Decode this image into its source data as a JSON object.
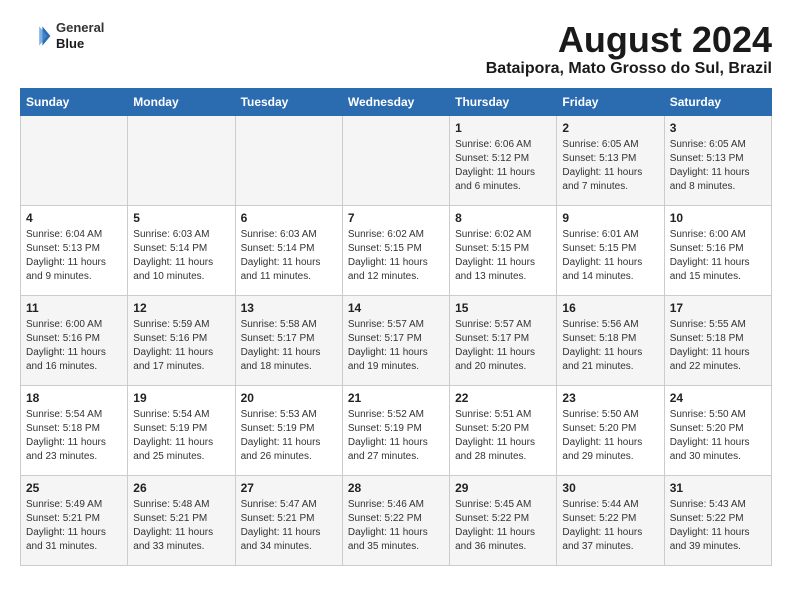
{
  "header": {
    "logo_line1": "General",
    "logo_line2": "Blue",
    "title": "August 2024",
    "subtitle": "Bataipora, Mato Grosso do Sul, Brazil"
  },
  "days_of_week": [
    "Sunday",
    "Monday",
    "Tuesday",
    "Wednesday",
    "Thursday",
    "Friday",
    "Saturday"
  ],
  "weeks": [
    [
      {
        "day": "",
        "info": ""
      },
      {
        "day": "",
        "info": ""
      },
      {
        "day": "",
        "info": ""
      },
      {
        "day": "",
        "info": ""
      },
      {
        "day": "1",
        "info": "Sunrise: 6:06 AM\nSunset: 5:12 PM\nDaylight: 11 hours\nand 6 minutes."
      },
      {
        "day": "2",
        "info": "Sunrise: 6:05 AM\nSunset: 5:13 PM\nDaylight: 11 hours\nand 7 minutes."
      },
      {
        "day": "3",
        "info": "Sunrise: 6:05 AM\nSunset: 5:13 PM\nDaylight: 11 hours\nand 8 minutes."
      }
    ],
    [
      {
        "day": "4",
        "info": "Sunrise: 6:04 AM\nSunset: 5:13 PM\nDaylight: 11 hours\nand 9 minutes."
      },
      {
        "day": "5",
        "info": "Sunrise: 6:03 AM\nSunset: 5:14 PM\nDaylight: 11 hours\nand 10 minutes."
      },
      {
        "day": "6",
        "info": "Sunrise: 6:03 AM\nSunset: 5:14 PM\nDaylight: 11 hours\nand 11 minutes."
      },
      {
        "day": "7",
        "info": "Sunrise: 6:02 AM\nSunset: 5:15 PM\nDaylight: 11 hours\nand 12 minutes."
      },
      {
        "day": "8",
        "info": "Sunrise: 6:02 AM\nSunset: 5:15 PM\nDaylight: 11 hours\nand 13 minutes."
      },
      {
        "day": "9",
        "info": "Sunrise: 6:01 AM\nSunset: 5:15 PM\nDaylight: 11 hours\nand 14 minutes."
      },
      {
        "day": "10",
        "info": "Sunrise: 6:00 AM\nSunset: 5:16 PM\nDaylight: 11 hours\nand 15 minutes."
      }
    ],
    [
      {
        "day": "11",
        "info": "Sunrise: 6:00 AM\nSunset: 5:16 PM\nDaylight: 11 hours\nand 16 minutes."
      },
      {
        "day": "12",
        "info": "Sunrise: 5:59 AM\nSunset: 5:16 PM\nDaylight: 11 hours\nand 17 minutes."
      },
      {
        "day": "13",
        "info": "Sunrise: 5:58 AM\nSunset: 5:17 PM\nDaylight: 11 hours\nand 18 minutes."
      },
      {
        "day": "14",
        "info": "Sunrise: 5:57 AM\nSunset: 5:17 PM\nDaylight: 11 hours\nand 19 minutes."
      },
      {
        "day": "15",
        "info": "Sunrise: 5:57 AM\nSunset: 5:17 PM\nDaylight: 11 hours\nand 20 minutes."
      },
      {
        "day": "16",
        "info": "Sunrise: 5:56 AM\nSunset: 5:18 PM\nDaylight: 11 hours\nand 21 minutes."
      },
      {
        "day": "17",
        "info": "Sunrise: 5:55 AM\nSunset: 5:18 PM\nDaylight: 11 hours\nand 22 minutes."
      }
    ],
    [
      {
        "day": "18",
        "info": "Sunrise: 5:54 AM\nSunset: 5:18 PM\nDaylight: 11 hours\nand 23 minutes."
      },
      {
        "day": "19",
        "info": "Sunrise: 5:54 AM\nSunset: 5:19 PM\nDaylight: 11 hours\nand 25 minutes."
      },
      {
        "day": "20",
        "info": "Sunrise: 5:53 AM\nSunset: 5:19 PM\nDaylight: 11 hours\nand 26 minutes."
      },
      {
        "day": "21",
        "info": "Sunrise: 5:52 AM\nSunset: 5:19 PM\nDaylight: 11 hours\nand 27 minutes."
      },
      {
        "day": "22",
        "info": "Sunrise: 5:51 AM\nSunset: 5:20 PM\nDaylight: 11 hours\nand 28 minutes."
      },
      {
        "day": "23",
        "info": "Sunrise: 5:50 AM\nSunset: 5:20 PM\nDaylight: 11 hours\nand 29 minutes."
      },
      {
        "day": "24",
        "info": "Sunrise: 5:50 AM\nSunset: 5:20 PM\nDaylight: 11 hours\nand 30 minutes."
      }
    ],
    [
      {
        "day": "25",
        "info": "Sunrise: 5:49 AM\nSunset: 5:21 PM\nDaylight: 11 hours\nand 31 minutes."
      },
      {
        "day": "26",
        "info": "Sunrise: 5:48 AM\nSunset: 5:21 PM\nDaylight: 11 hours\nand 33 minutes."
      },
      {
        "day": "27",
        "info": "Sunrise: 5:47 AM\nSunset: 5:21 PM\nDaylight: 11 hours\nand 34 minutes."
      },
      {
        "day": "28",
        "info": "Sunrise: 5:46 AM\nSunset: 5:22 PM\nDaylight: 11 hours\nand 35 minutes."
      },
      {
        "day": "29",
        "info": "Sunrise: 5:45 AM\nSunset: 5:22 PM\nDaylight: 11 hours\nand 36 minutes."
      },
      {
        "day": "30",
        "info": "Sunrise: 5:44 AM\nSunset: 5:22 PM\nDaylight: 11 hours\nand 37 minutes."
      },
      {
        "day": "31",
        "info": "Sunrise: 5:43 AM\nSunset: 5:22 PM\nDaylight: 11 hours\nand 39 minutes."
      }
    ]
  ]
}
